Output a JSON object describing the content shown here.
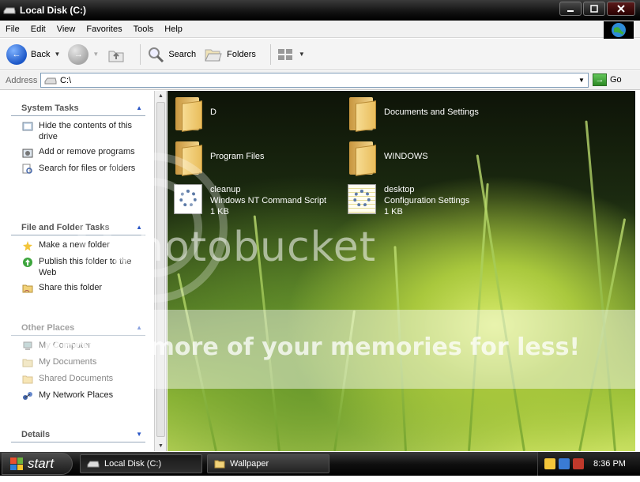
{
  "window": {
    "title": "Local Disk (C:)"
  },
  "menu": [
    "File",
    "Edit",
    "View",
    "Favorites",
    "Tools",
    "Help"
  ],
  "toolbar": {
    "back_label": "Back",
    "search_label": "Search",
    "folders_label": "Folders"
  },
  "address": {
    "label": "Address",
    "value": "C:\\",
    "go_label": "Go"
  },
  "task_groups": [
    {
      "title": "System Tasks",
      "items": [
        {
          "label": "Hide the contents of this drive",
          "icon": "hide-contents-icon"
        },
        {
          "label": "Add or remove programs",
          "icon": "add-remove-programs-icon"
        },
        {
          "label": "Search for files or folders",
          "icon": "search-files-icon"
        }
      ]
    },
    {
      "title": "File and Folder Tasks",
      "items": [
        {
          "label": "Make a new folder",
          "icon": "new-folder-icon"
        },
        {
          "label": "Publish this folder to the Web",
          "icon": "publish-web-icon"
        },
        {
          "label": "Share this folder",
          "icon": "share-folder-icon"
        }
      ]
    },
    {
      "title": "Other Places",
      "items": [
        {
          "label": "My Computer",
          "icon": "my-computer-icon"
        },
        {
          "label": "My Documents",
          "icon": "my-documents-icon"
        },
        {
          "label": "Shared Documents",
          "icon": "shared-documents-icon"
        },
        {
          "label": "My Network Places",
          "icon": "network-places-icon"
        }
      ]
    },
    {
      "title": "Details",
      "items": []
    }
  ],
  "files": [
    {
      "name": "D",
      "type": "folder"
    },
    {
      "name": "Documents and Settings",
      "type": "folder"
    },
    {
      "name": "Program Files",
      "type": "folder"
    },
    {
      "name": "WINDOWS",
      "type": "folder"
    },
    {
      "name": "cleanup",
      "type": "file",
      "kind": "Windows NT Command Script",
      "size": "1 KB"
    },
    {
      "name": "desktop",
      "type": "file",
      "kind": "Configuration Settings",
      "size": "1 KB"
    }
  ],
  "watermark": {
    "line1": "photobucket",
    "line2": "Protect more of your memories for less!"
  },
  "taskbar": {
    "start_label": "start",
    "tasks": [
      "Local Disk (C:)",
      "Wallpaper"
    ],
    "clock": "8:36 PM"
  }
}
